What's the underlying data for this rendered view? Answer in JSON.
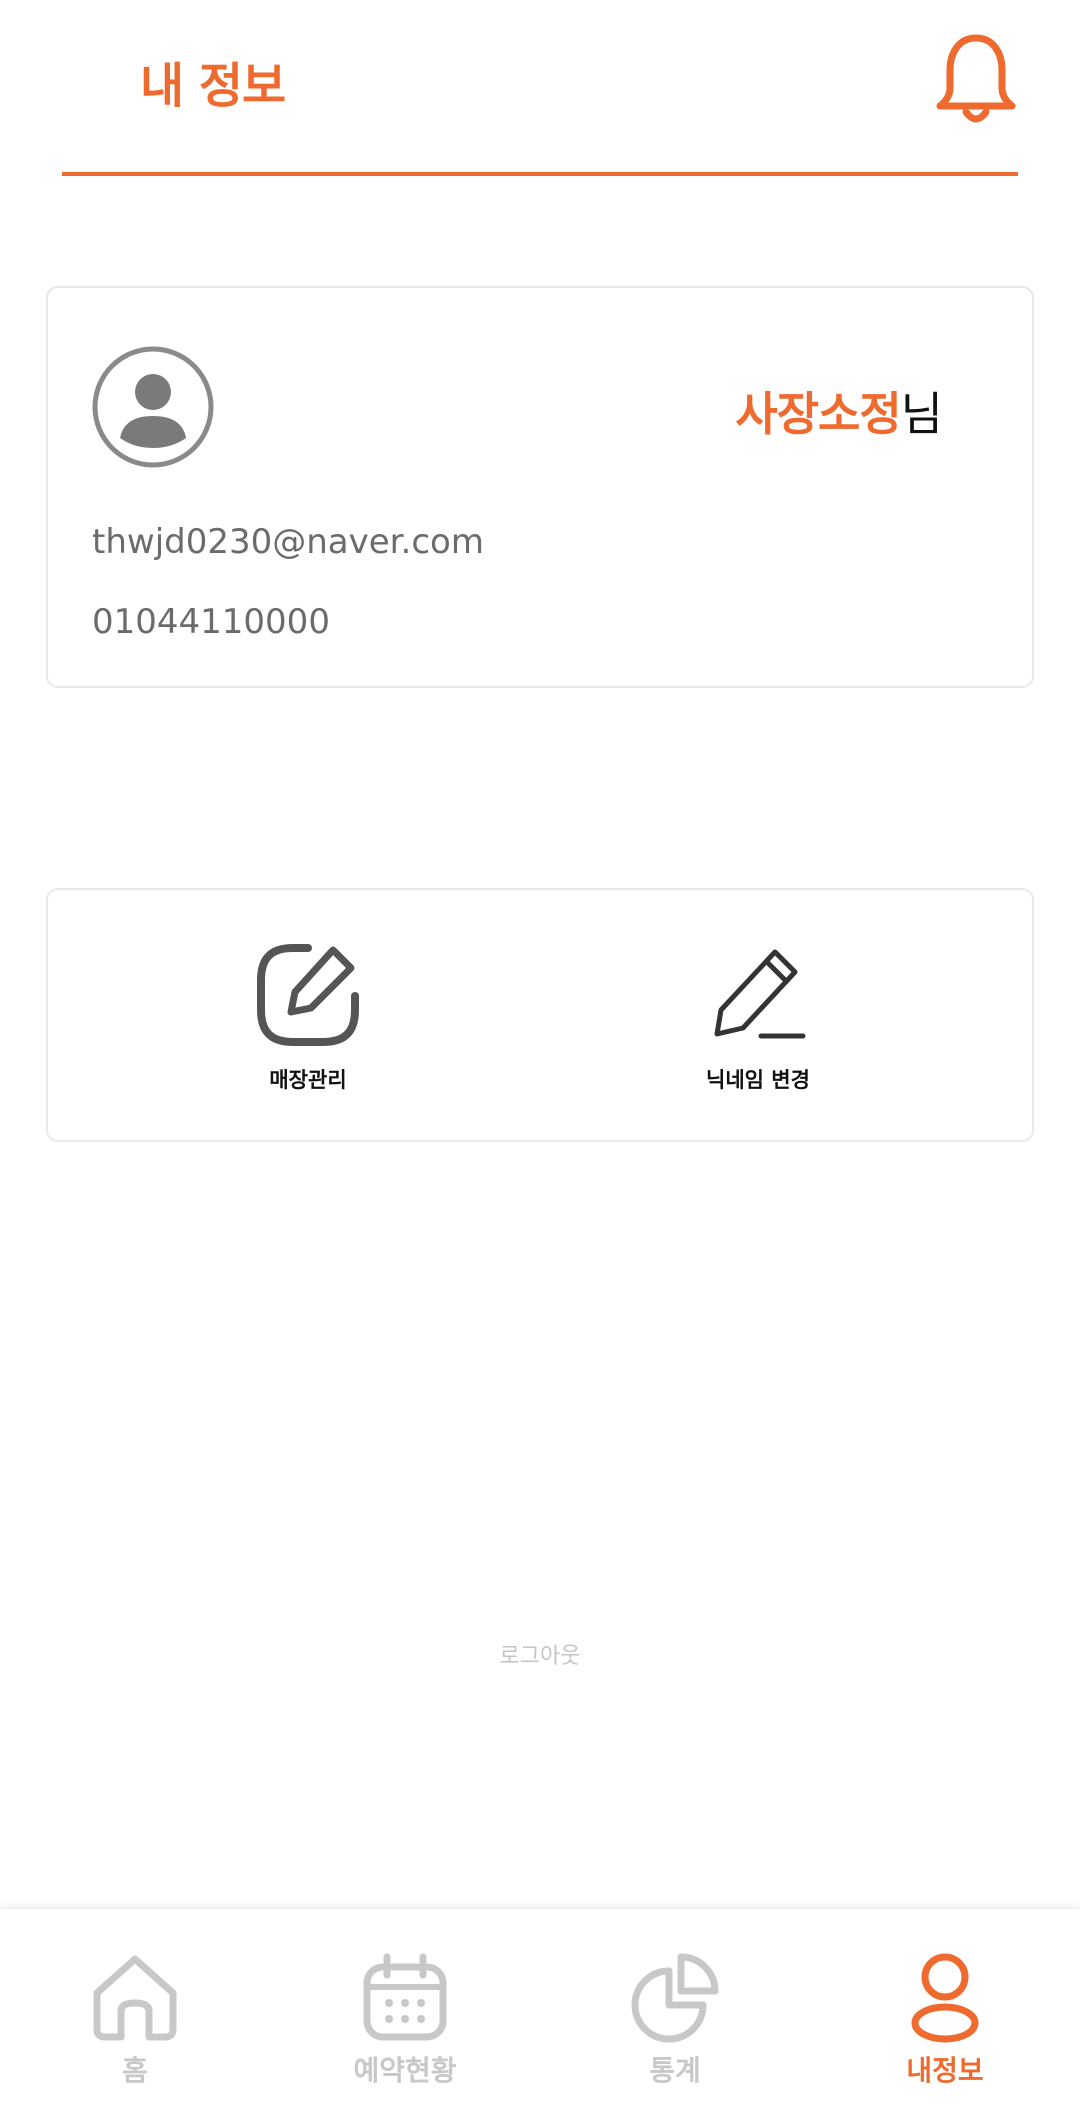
{
  "header": {
    "title": "내 정보",
    "accent_color": "#EE6A2E"
  },
  "profile": {
    "name": "사장소정",
    "name_suffix": "님",
    "email": "thwjd0230@naver.com",
    "phone": "01044110000"
  },
  "menu": {
    "items": [
      {
        "label": "매장관리",
        "icon": "edit-square-icon"
      },
      {
        "label": "닉네임 변경",
        "icon": "pencil-icon"
      }
    ]
  },
  "logout_label": "로그아웃",
  "bottom_nav": {
    "items": [
      {
        "label": "홈",
        "icon": "home-icon",
        "active": false
      },
      {
        "label": "예약현황",
        "icon": "calendar-icon",
        "active": false
      },
      {
        "label": "통계",
        "icon": "pie-chart-icon",
        "active": false
      },
      {
        "label": "내정보",
        "icon": "user-icon",
        "active": true
      }
    ],
    "active_color": "#EE6A2E",
    "inactive_color": "#C8C8C8"
  }
}
